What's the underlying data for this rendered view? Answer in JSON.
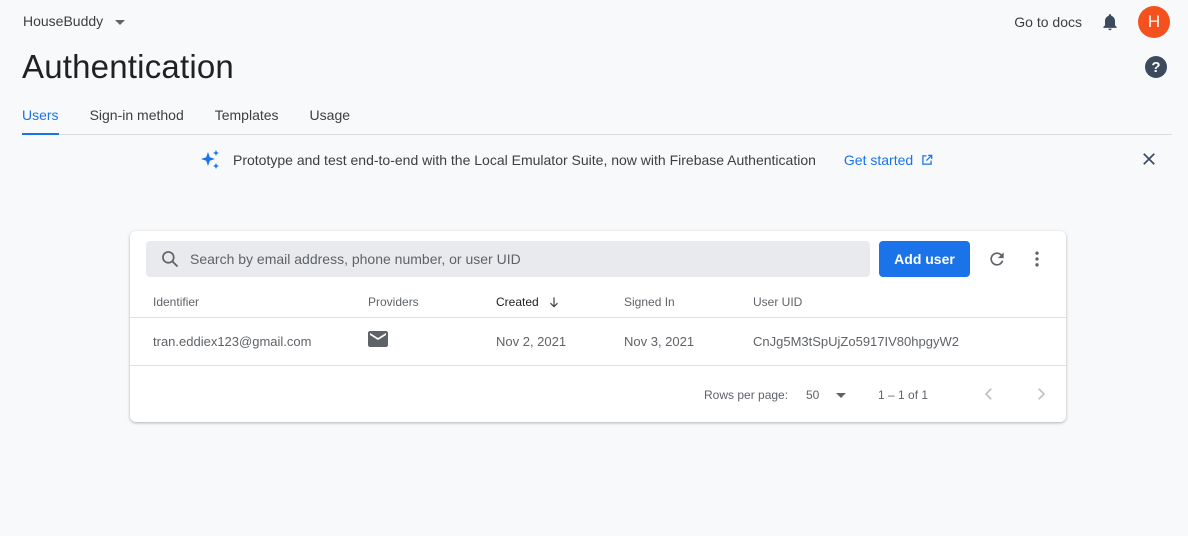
{
  "header": {
    "project_name": "HouseBuddy",
    "docs_label": "Go to docs",
    "avatar_initial": "H",
    "page_title": "Authentication",
    "help_symbol": "?"
  },
  "tabs": [
    {
      "label": "Users",
      "active": true
    },
    {
      "label": "Sign-in method",
      "active": false
    },
    {
      "label": "Templates",
      "active": false
    },
    {
      "label": "Usage",
      "active": false
    }
  ],
  "banner": {
    "text": "Prototype and test end-to-end with the Local Emulator Suite, now with Firebase Authentication",
    "link_label": "Get started"
  },
  "users_table": {
    "search_placeholder": "Search by email address, phone number, or user UID",
    "add_user_label": "Add user",
    "columns": [
      "Identifier",
      "Providers",
      "Created",
      "Signed In",
      "User UID"
    ],
    "sorted_column": "Created",
    "rows": [
      {
        "identifier": "tran.eddiex123@gmail.com",
        "provider_icon": "mail-icon",
        "created": "Nov 2, 2021",
        "signed_in": "Nov 3, 2021",
        "uid": "CnJg5M3tSpUjZo5917IV80hpgyW2"
      }
    ],
    "footer": {
      "rows_per_page_label": "Rows per page:",
      "rows_per_page": "50",
      "range": "1 – 1 of 1"
    }
  },
  "colors": {
    "accent": "#1a73e8",
    "avatar": "#f4511e",
    "background": "#f8f9fa"
  }
}
